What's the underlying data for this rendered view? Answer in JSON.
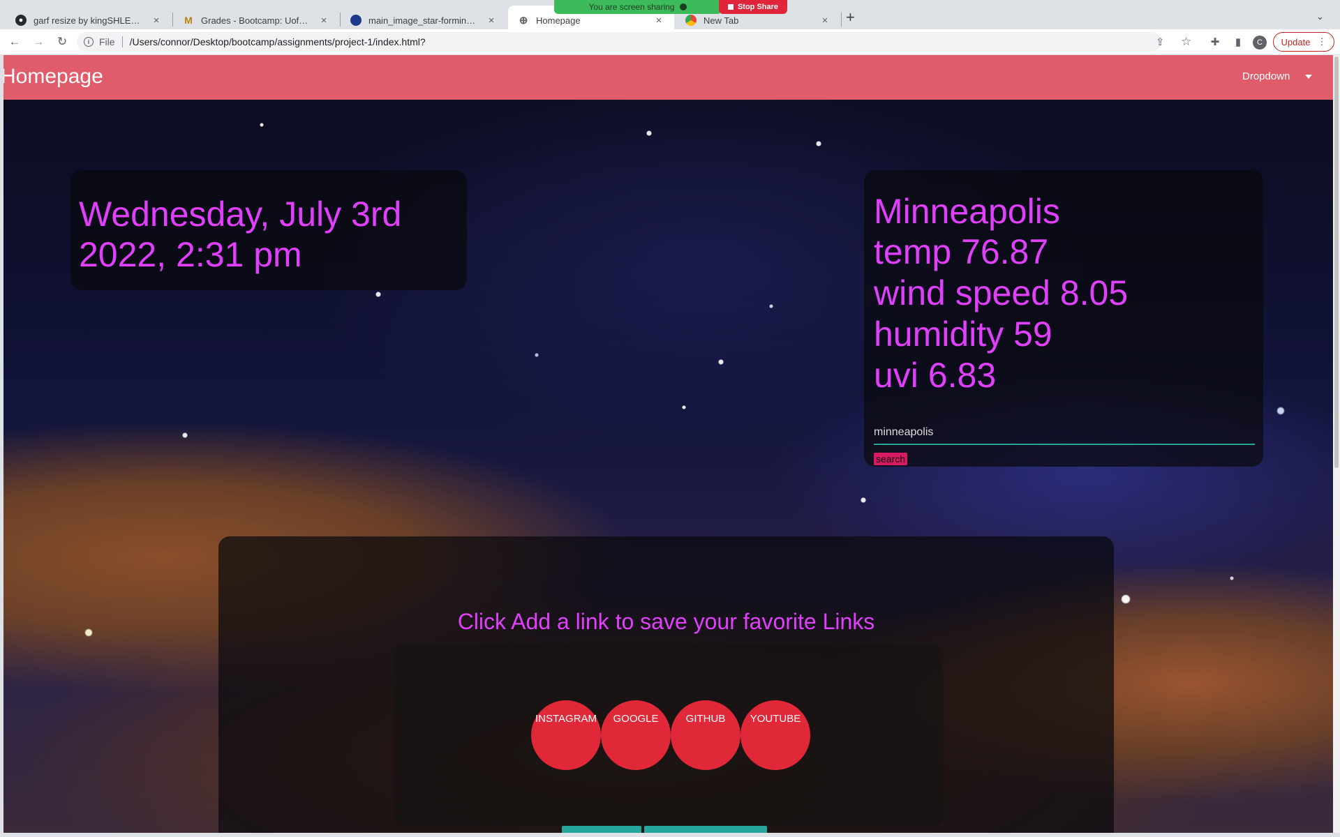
{
  "browser": {
    "tabs": [
      {
        "title": "garf resize by kingSHLERM · P",
        "icon": "github-icon"
      },
      {
        "title": "Grades - Bootcamp: UofM-VIR",
        "icon": "umn-logo-icon"
      },
      {
        "title": "main_image_star-forming_regi",
        "icon": "nasa-logo-icon"
      },
      {
        "title": "Homepage",
        "icon": "globe-icon"
      },
      {
        "title": "New Tab",
        "icon": "chrome-icon"
      }
    ],
    "new_tab_symbol": "+",
    "screen_share": {
      "text": "You are screen sharing",
      "stop_label": "Stop Share"
    },
    "address": {
      "scheme_label": "File",
      "url": "/Users/connor/Desktop/bootcamp/assignments/project-1/index.html?"
    },
    "profile_initial": "C",
    "update_label": "Update",
    "colors": {
      "chrome_bg": "#dee1e6",
      "update": "#c5221f"
    }
  },
  "page": {
    "brand": "Homepage",
    "dropdown_label": "Dropdown",
    "date_text": "Wednesday, July 3rd 2022, 2:31 pm",
    "weather": {
      "city": "Minneapolis",
      "temp": "temp 76.87",
      "wind": "wind speed 8.05",
      "humidity": "humidity 59",
      "uvi": "uvi 6.83",
      "input_value": "minneapolis",
      "search_label": "search"
    },
    "links": {
      "title": "Click Add a link to save your favorite Links",
      "items": [
        "INSTAGRAM",
        "GOOGLE",
        "GITHUB",
        "YOUTUBE"
      ]
    },
    "colors": {
      "navbar": "#e05c6b",
      "accent_text": "#e040fb",
      "link_button": "#e02838",
      "input_underline": "#26a69a"
    }
  }
}
